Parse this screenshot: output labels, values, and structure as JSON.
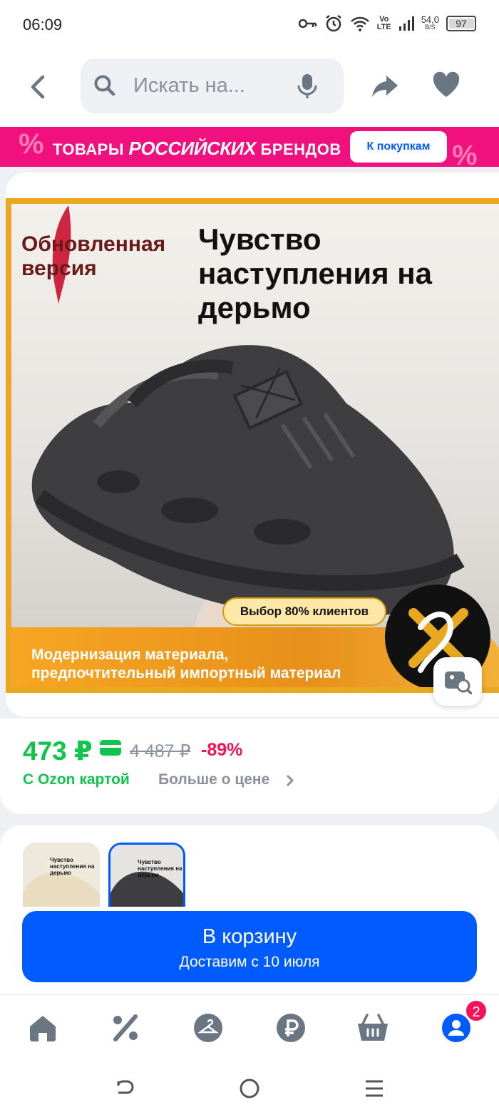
{
  "status_bar": {
    "time": "06:09",
    "network_type": "Vo\nLTE",
    "net_speed_value": "54,0",
    "net_speed_unit": "B/S",
    "battery": "97"
  },
  "header": {
    "search_placeholder": "Искать на...",
    "icons": [
      "back-arrow-icon",
      "search-icon",
      "microphone-icon",
      "share-icon",
      "heart-icon"
    ]
  },
  "promo": {
    "text_prefix": "ТОВАРЫ",
    "text_highlight": "РОССИЙСКИХ",
    "text_suffix": "БРЕНДОВ",
    "button_label": "К покупкам",
    "color": "#f1117e"
  },
  "product_image": {
    "badge": "Обновленная\nверсия",
    "headline": "Чувство\nнаступления на\nдерьмо",
    "choice_label": "Выбор 80% клиентов",
    "caption": "Модернизация материала,\nпредпочтительный импортный материал"
  },
  "price": {
    "current": "473 ₽",
    "old": "4 487 ₽",
    "discount": "-89%",
    "ozon_card_label": "С Ozon картой",
    "more_label": "Больше о цене",
    "accent_green": "#10c44c",
    "accent_red": "#f91155"
  },
  "variants": [
    {
      "caption": "Чувство\nнаступления на\nдерьмо",
      "color": "beige",
      "selected": false
    },
    {
      "caption": "Чувство\nнаступления на\nдерьмо",
      "color": "black",
      "selected": true
    }
  ],
  "cart_button": {
    "title": "В корзину",
    "subtitle": "Доставим с 10 июля",
    "color": "#005bff"
  },
  "bottom_nav": {
    "items": [
      "home-icon",
      "discount-icon",
      "catalog-icon",
      "ruble-icon",
      "cart-icon",
      "profile-icon"
    ],
    "profile_badge": "2"
  },
  "system_nav": {
    "items": [
      "back-icon",
      "home-circle-icon",
      "menu-icon"
    ]
  }
}
